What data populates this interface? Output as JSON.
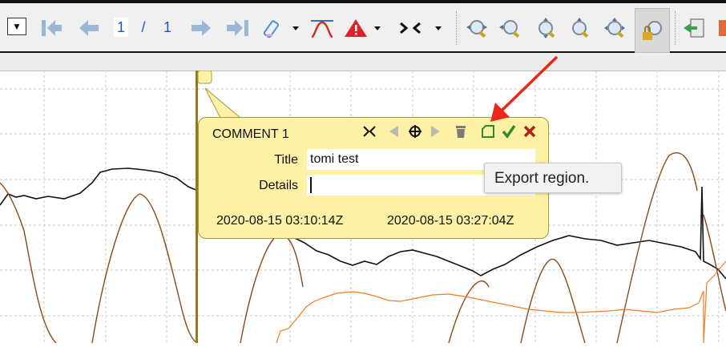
{
  "toolbar": {
    "dropdown_glyph": "▼",
    "page_current": "1",
    "page_separator": "/",
    "page_total": "1",
    "icons": [
      "first-page-icon",
      "previous-page-icon",
      "next-page-icon",
      "last-page-icon",
      "highlighter-icon",
      "waveform-icon",
      "warning-icon",
      "collapse-arrows-icon",
      "zoom-in-icon",
      "zoom-out-icon",
      "zoom-vertical-in-icon",
      "zoom-vertical-out-icon",
      "zoom-fit-icon",
      "zoom-lock-icon",
      "export-icon"
    ]
  },
  "comment": {
    "title": "COMMENT 1",
    "title_label": "Title",
    "title_value": "tomi test",
    "details_label": "Details",
    "details_value": "",
    "start_time": "2020-08-15 03:10:14Z",
    "end_time": "2020-08-15 03:27:04Z",
    "icons": [
      "collapse-icon",
      "previous-icon",
      "move-icon",
      "next-icon",
      "delete-icon",
      "export-region-icon",
      "confirm-check-icon",
      "close-x-icon"
    ]
  },
  "tooltip": {
    "text": "Export region."
  },
  "colors": {
    "popup_bg": "#fcf1a4",
    "annotation_arrow": "#e8281c",
    "marker_line": "#8e7a1c",
    "trace_black": "#111111",
    "trace_brown": "#8b4a1a",
    "trace_orange": "#f47c20",
    "page_number": "#1a56c8"
  }
}
